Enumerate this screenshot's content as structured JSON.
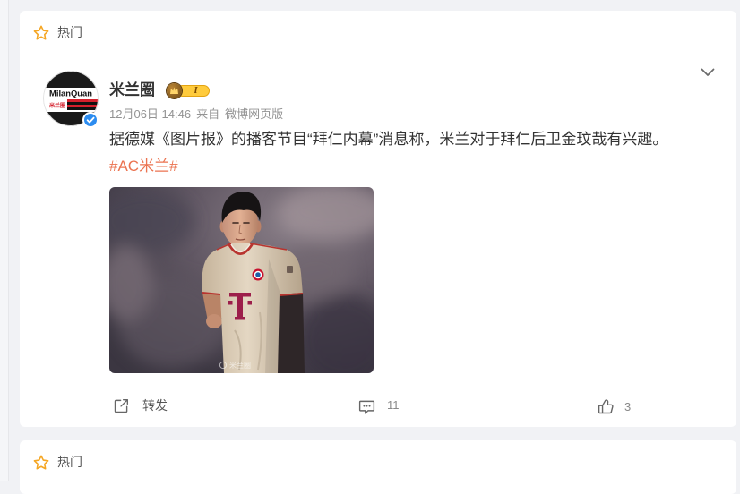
{
  "post": {
    "section_label": "热门",
    "author": {
      "name": "米兰圈",
      "level_badge": "I",
      "avatar": {
        "logo_text": "MilanQuan",
        "logo_subtext": "米兰圈"
      }
    },
    "time": "12月06日 14:46",
    "source_prefix": "来自",
    "source": "微博网页版",
    "text": "据德媒《图片报》的播客节目“拜仁内幕”消息称，米兰对于拜仁后卫金玟哉有兴趣。",
    "hashtag": "#AC米兰#",
    "image": {
      "watermark": "米兰圈"
    },
    "actions": {
      "repost_label": "转发",
      "comment_count": "11",
      "like_count": "3"
    }
  },
  "next_post": {
    "section_label": "热门"
  },
  "icons": {
    "section": "star-icon",
    "more": "chevron-down-icon",
    "verified": "verified-icon",
    "level": "crown-icon",
    "repost": "repost-icon",
    "comment": "comment-icon",
    "like": "like-icon"
  },
  "colors": {
    "page_bg": "#f1f2f5",
    "card_bg": "#ffffff",
    "link": "#eb7350",
    "star": "#f5a623",
    "verified": "#2c8cf0",
    "level_badge": "#ffcb3c"
  }
}
